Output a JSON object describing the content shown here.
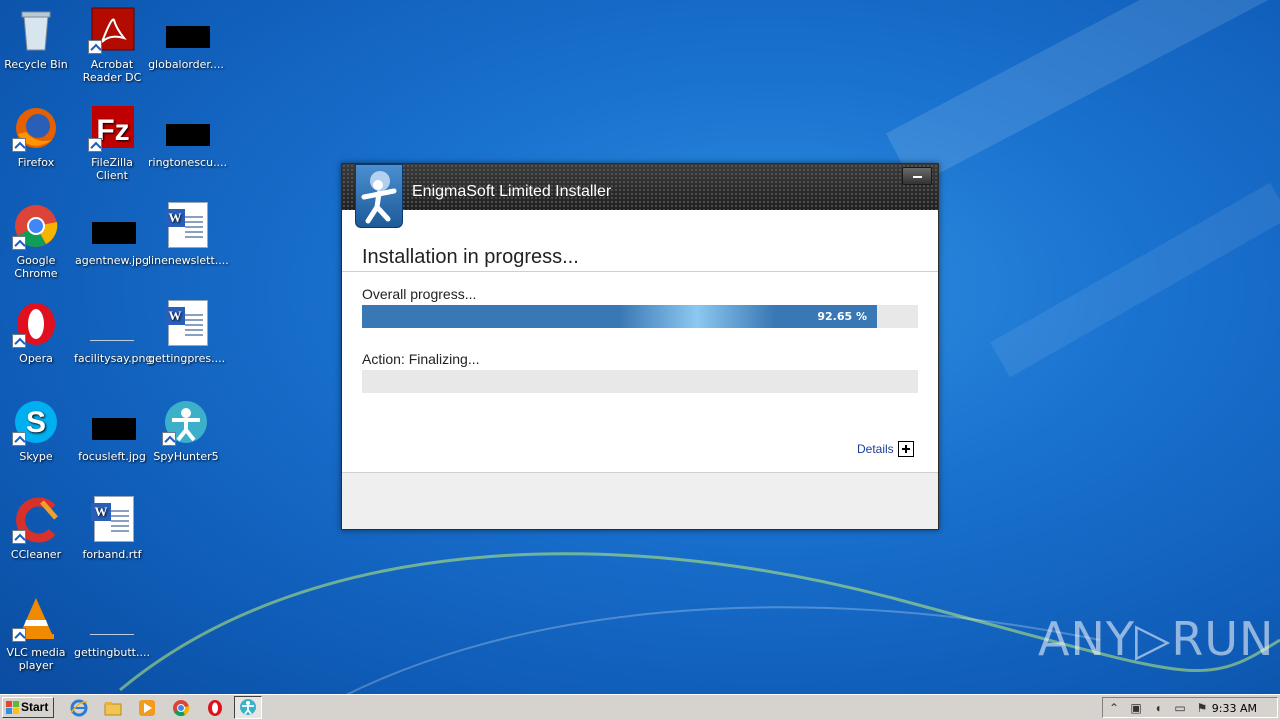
{
  "desktop": {
    "icons": [
      {
        "label": "Recycle Bin",
        "icon": "recycle-bin-icon"
      },
      {
        "label": "Acrobat\nReader DC",
        "icon": "acrobat-icon"
      },
      {
        "label": "globalorder....",
        "icon": "image-file-icon"
      },
      {
        "label": "Firefox",
        "icon": "firefox-icon"
      },
      {
        "label": "FileZilla Client",
        "icon": "filezilla-icon"
      },
      {
        "label": "ringtonescu....",
        "icon": "image-file-icon"
      },
      {
        "label": "Google\nChrome",
        "icon": "chrome-icon"
      },
      {
        "label": "agentnew.jpg",
        "icon": "image-file-icon"
      },
      {
        "label": "linenewslett....",
        "icon": "word-document-icon"
      },
      {
        "label": "Opera",
        "icon": "opera-icon"
      },
      {
        "label": "facilitysay.png",
        "icon": "image-file-icon"
      },
      {
        "label": "gettingpres....",
        "icon": "word-document-icon"
      },
      {
        "label": "Skype",
        "icon": "skype-icon"
      },
      {
        "label": "focusleft.jpg",
        "icon": "image-file-icon"
      },
      {
        "label": "SpyHunter5",
        "icon": "spyhunter-icon"
      },
      {
        "label": "CCleaner",
        "icon": "ccleaner-icon"
      },
      {
        "label": "forband.rtf",
        "icon": "word-document-icon"
      },
      {
        "label": "VLC media\nplayer",
        "icon": "vlc-icon"
      },
      {
        "label": "gettingbutt....",
        "icon": "image-file-icon"
      }
    ]
  },
  "installer": {
    "title": "EnigmaSoft Limited Installer",
    "heading": "Installation in progress...",
    "overall_label": "Overall progress...",
    "overall_percent_text": "92.65 %",
    "overall_progress": 0.9265,
    "action_label": "Action: Finalizing...",
    "action_progress": 0,
    "details_label": "Details"
  },
  "watermark": {
    "text": "ANY▷RUN"
  },
  "taskbar": {
    "start_label": "Start",
    "clock": "9:33 AM"
  },
  "colors": {
    "desktop_blue": "#1a72cf",
    "progress_blue": "#3a78b5",
    "installer_header": "#2a2a2a"
  }
}
